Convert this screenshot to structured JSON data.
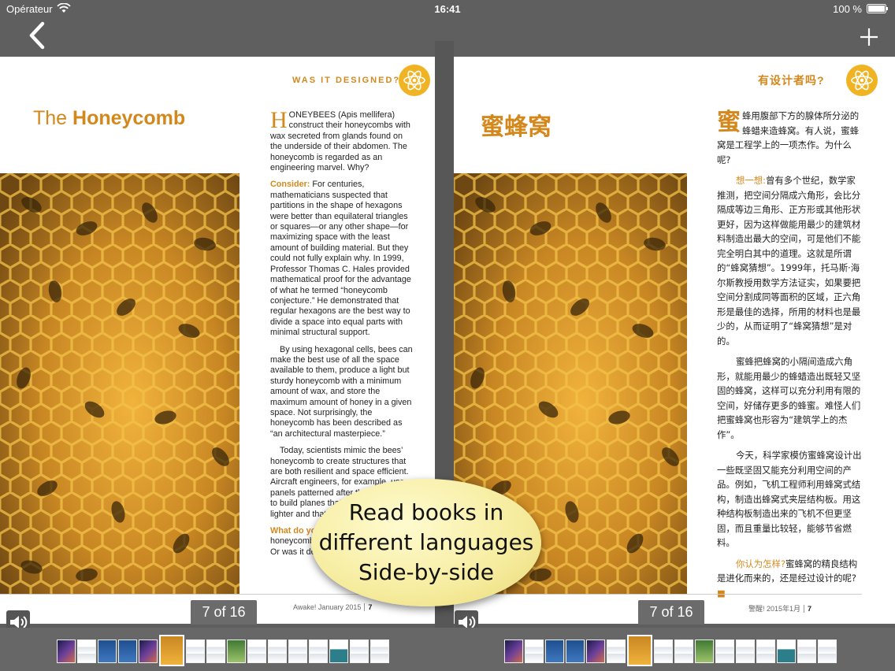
{
  "status_bar": {
    "carrier": "Opérateur",
    "time": "16:41",
    "battery": "100 %"
  },
  "nav": {
    "back_icon": "chevron-left-icon",
    "add_icon": "plus-icon"
  },
  "left_page": {
    "kicker": "WAS IT DESIGNED?",
    "title_prefix": "The ",
    "title_main": "Honeycomb",
    "dropcap": "H",
    "para1": "ONEYBEES (Apis mellifera) construct their honeycombs with wax secreted from glands found on the underside of their abdomen. The honeycomb is regarded as an engineering marvel. Why?",
    "consider_label": "Consider:",
    "para2": " For centuries, mathematicians suspected that partitions in the shape of hexagons were better than equilateral triangles or squares—or any other shape—for maximizing space with the least amount of building material. But they could not fully explain why. In 1999, Professor Thomas C. Hales provided mathematical proof for the advantage of what he termed “honeycomb conjecture.” He demonstrated that regular hexagons are the best way to divide a space into equal parts with minimal structural support.",
    "para3": "By using hexagonal cells, bees can make the best use of all the space available to them, produce a light but sturdy honeycomb with a minimum amount of wax, and store the maximum amount of honey in a given space. Not surprisingly, the honeycomb has been described as “an architectural masterpiece.”",
    "para4": "Today, scientists mimic the bees’ honeycomb to create structures that are both resilient and space efficient. Aircraft engineers, for example, use panels patterned after the honeycomb to build planes that are stronger and lighter and that require less fuel.",
    "think_label": "What do you think?",
    "para5": " Did the honeycomb come about by evolution? Or was it designed?",
    "folio_text": "Awake! January 2015",
    "folio_num": "7",
    "page_counter": "7 of 16"
  },
  "right_page": {
    "kicker": "有设计者吗?",
    "title": "蜜蜂窝",
    "dropcap": "蜜",
    "para1": "蜂用腹部下方的腺体所分泌的蜂蜡来造蜂窝。有人说，蜜蜂窝是工程学上的一项杰作。为什么呢?",
    "consider_label": "想一想:",
    "para2": "曾有多个世纪，数学家推测，把空间分隔成六角形，会比分隔成等边三角形、正方形或其他形状更好，因为这样做能用最少的建筑材料制造出最大的空间，可是他们不能完全明白其中的道理。这就是所谓的“蜂窝猜想”。1999年，托马斯·海尔斯教授用数学方法证实，如果要把空间分割成同等面积的区域，正六角形是最佳的选择，所用的材料也是最少的，从而证明了“蜂窝猜想”是对的。",
    "para3": "蜜蜂把蜂窝的小隔间造成六角形，就能用最少的蜂蜡造出既轻又坚固的蜂窝，这样可以充分利用有限的空间，好储存更多的蜂蜜。难怪人们把蜜蜂窝也形容为“建筑学上的杰作”。",
    "para4": "今天，科学家模仿蜜蜂窝设计出一些既坚固又能充分利用空间的产品。例如，飞机工程师利用蜂窝式结构，制造出蜂窝式夹层结构板。用这种结构板制造出来的飞机不但更坚固，而且重量比较轻，能够节省燃料。",
    "think_label": "你认为怎样?",
    "para5": "蜜蜂窝的精良结构是进化而来的，还是经过设计的呢?",
    "folio_text": "警醒! 2015年1月",
    "folio_num": "7",
    "page_counter": "7 of 16"
  },
  "callout": {
    "line1": "Read books in",
    "line2": "different languages",
    "line3": "Side-by-side"
  },
  "colors": {
    "accent": "#d4881c",
    "badge": "#f0b323",
    "chrome": "#5f5f5f"
  },
  "thumbnails_left": [
    "space",
    "doc",
    "blue",
    "blue",
    "space",
    "honey-selected",
    "doc",
    "doc",
    "green",
    "doc",
    "doc",
    "doc",
    "doc",
    "teal",
    "doc",
    "doc"
  ],
  "thumbnails_right": [
    "space",
    "doc",
    "blue",
    "blue",
    "space",
    "doc",
    "honey-selected",
    "doc",
    "doc",
    "green",
    "doc",
    "doc",
    "doc",
    "teal",
    "doc",
    "doc"
  ]
}
